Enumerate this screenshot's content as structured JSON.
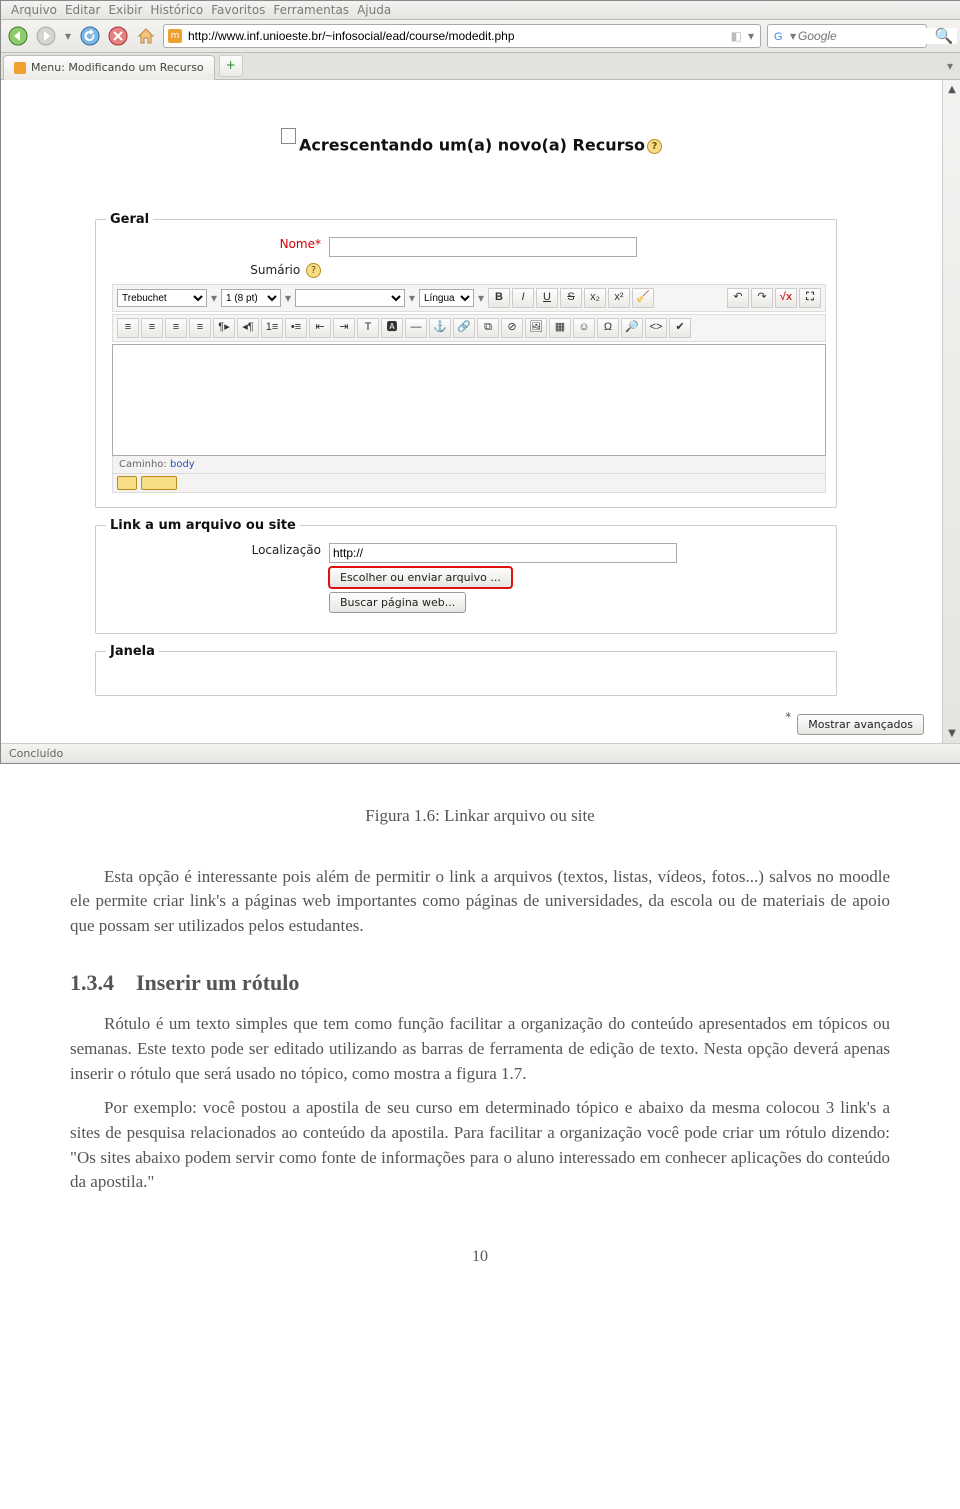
{
  "menubar": [
    "Arquivo",
    "Editar",
    "Exibir",
    "Histórico",
    "Favoritos",
    "Ferramentas",
    "Ajuda"
  ],
  "url": "http://www.inf.unioeste.br/~infosocial/ead/course/modedit.php",
  "search_placeholder": "Google",
  "tab_title": "Menu: Modificando um Recurso",
  "page_header": "Acrescentando um(a) novo(a) Recurso",
  "status_text": "Concluído",
  "fieldsets": {
    "geral": {
      "legend": "Geral",
      "nome_label": "Nome*",
      "sumario_label": "Sumário",
      "font_sel": "Trebuchet",
      "size_sel": "1 (8 pt)",
      "lang_sel": "Língua",
      "path_label": "Caminho:",
      "path_value": "body"
    },
    "link": {
      "legend": "Link a um arquivo ou site",
      "loc_label": "Localização",
      "loc_value": "http://",
      "btn_choose": "Escolher ou enviar arquivo ...",
      "btn_search": "Buscar página web..."
    },
    "janela": {
      "legend": "Janela"
    }
  },
  "adv_button": "Mostrar avançados",
  "document": {
    "caption": "Figura 1.6: Linkar arquivo ou site",
    "p1": "Esta opção é interessante pois além de permitir o link a arquivos (textos, listas, vídeos, fotos...) salvos no moodle ele permite criar link's a páginas web importantes como páginas de universidades, da escola ou de materiais de apoio que possam ser utilizados pelos estudantes.",
    "h2_num": "1.3.4",
    "h2_title": "Inserir um rótulo",
    "p2": "Rótulo é um texto simples que tem como função facilitar a organização do conteúdo apresentados em tópicos ou semanas. Este texto pode ser editado utilizando as barras de ferramenta de edição de texto. Nesta opção deverá apenas inserir o rótulo que será usado no tópico, como mostra a figura 1.7.",
    "p3": "Por exemplo: você postou a apostila de seu curso em determinado tópico e abaixo da mesma colocou 3 link's a sites de pesquisa relacionados ao conteúdo da apostila. Para facilitar a organização você pode criar um rótulo dizendo: \"Os sites abaixo podem servir como fonte de informações para o aluno interessado em conhecer aplicações do conteúdo da apostila.\"",
    "page_number": "10"
  }
}
